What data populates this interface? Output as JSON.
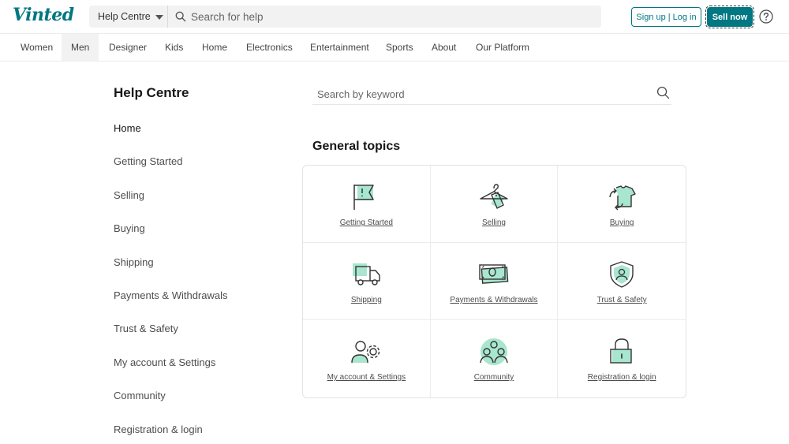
{
  "header": {
    "logo": "Vinted",
    "category_select": "Help Centre",
    "search_placeholder": "Search for help",
    "signup_label": "Sign up",
    "separator": "|",
    "login_label": "Log in",
    "sell_label": "Sell now"
  },
  "catnav": [
    "Women",
    "Men",
    "Designer",
    "Kids",
    "Home",
    "Electronics",
    "Entertainment",
    "Sports",
    "About",
    "Our Platform"
  ],
  "sidebar": {
    "title": "Help Centre",
    "items": [
      "Home",
      "Getting Started",
      "Selling",
      "Buying",
      "Shipping",
      "Payments & Withdrawals",
      "Trust & Safety",
      "My account & Settings",
      "Community",
      "Registration & login"
    ]
  },
  "main": {
    "keyword_placeholder": "Search by keyword",
    "topics_title": "General topics",
    "topics": [
      {
        "label": "Getting Started",
        "icon": "flag-icon"
      },
      {
        "label": "Selling",
        "icon": "hanger-tag-icon"
      },
      {
        "label": "Buying",
        "icon": "tshirt-icon"
      },
      {
        "label": "Shipping",
        "icon": "truck-icon"
      },
      {
        "label": "Payments & Withdrawals",
        "icon": "banknote-icon"
      },
      {
        "label": "Trust & Safety",
        "icon": "shield-user-icon"
      },
      {
        "label": "My account & Settings",
        "icon": "user-gear-icon"
      },
      {
        "label": "Community",
        "icon": "community-icon"
      },
      {
        "label": "Registration & login",
        "icon": "padlock-icon"
      }
    ]
  },
  "colors": {
    "brand": "#007782",
    "accent_mint": "#a8e6cf"
  }
}
